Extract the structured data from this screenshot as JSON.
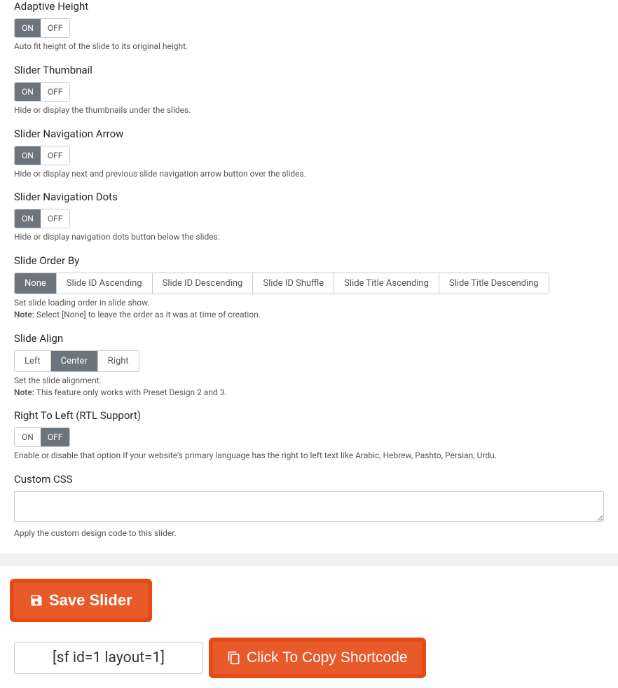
{
  "fields": {
    "adaptive_height": {
      "label": "Adaptive Height",
      "on": "ON",
      "off": "OFF",
      "value": "on",
      "desc": "Auto fit height of the slide to its original height."
    },
    "slider_thumbnail": {
      "label": "Slider Thumbnail",
      "on": "ON",
      "off": "OFF",
      "value": "on",
      "desc": "Hide or display the thumbnails under the slides."
    },
    "nav_arrow": {
      "label": "Slider Navigation Arrow",
      "on": "ON",
      "off": "OFF",
      "value": "on",
      "desc": "Hide or display next and previous slide navigation arrow button over the slides."
    },
    "nav_dots": {
      "label": "Slider Navigation Dots",
      "on": "ON",
      "off": "OFF",
      "value": "on",
      "desc": "Hide or display navigation dots button below the slides."
    },
    "order_by": {
      "label": "Slide Order By",
      "options": [
        "None",
        "Slide ID Ascending",
        "Slide ID Descending",
        "Slide ID Shuffle",
        "Slide Title Ascending",
        "Slide Title Descending"
      ],
      "value": "None",
      "desc": "Set slide loading order in slide show.",
      "note_label": "Note:",
      "note": " Select [None] to leave the order as it was at time of creation."
    },
    "slide_align": {
      "label": "Slide Align",
      "options": [
        "Left",
        "Center",
        "Right"
      ],
      "value": "Center",
      "desc": "Set the slide alignment.",
      "note_label": "Note:",
      "note": " This feature only works with Preset Design 2 and 3."
    },
    "rtl": {
      "label": "Right To Left (RTL Support)",
      "on": "ON",
      "off": "OFF",
      "value": "off",
      "desc": "Enable or disable that option If your website's primary language has the right to left text like Arabic, Hebrew, Pashto, Persian, Urdu."
    },
    "custom_css": {
      "label": "Custom CSS",
      "value": "",
      "desc": "Apply the custom design code to this slider."
    }
  },
  "footer": {
    "save_label": "Save Slider",
    "shortcode": "[sf id=1 layout=1]",
    "copy_label": "Click To Copy Shortcode"
  }
}
